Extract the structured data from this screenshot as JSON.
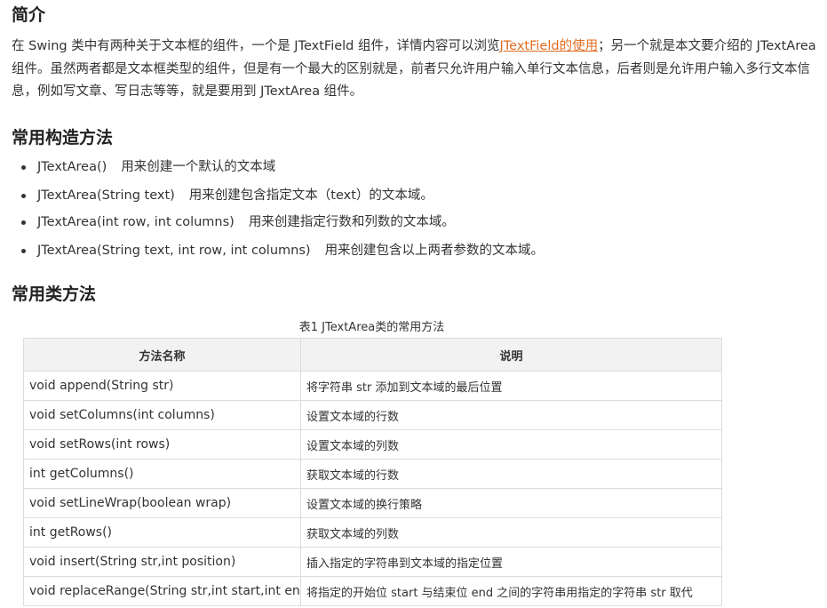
{
  "intro": {
    "heading": "简介",
    "text_before_link": "在 Swing 类中有两种关于文本框的组件，一个是 JTextField 组件，详情内容可以浏览",
    "link_text": "JTextField的使用",
    "text_after_link": "；另一个就是本文要介绍的 JTextArea 组件。虽然两者都是文本框类型的组件，但是有一个最大的区别就是，前者只允许用户输入单行文本信息，后者则是允许用户输入多行文本信息，例如写文章、写日志等等，就是要用到 JTextArea 组件。"
  },
  "constructors": {
    "heading": "常用构造方法",
    "items": [
      {
        "signature": "JTextArea()",
        "description": "用来创建一个默认的文本域"
      },
      {
        "signature": "JTextArea(String text)",
        "description": "用来创建包含指定文本（text）的文本域。"
      },
      {
        "signature": "JTextArea(int row, int columns)",
        "description": "用来创建指定行数和列数的文本域。"
      },
      {
        "signature": "JTextArea(String text, int row, int columns)",
        "description": "用来创建包含以上两者参数的文本域。"
      }
    ]
  },
  "methods": {
    "heading": "常用类方法",
    "caption": "表1 JTextArea类的常用方法",
    "columns": [
      "方法名称",
      "说明"
    ],
    "rows": [
      [
        "void append(String str)",
        "将字符串 str 添加到文本域的最后位置"
      ],
      [
        "void setColumns(int columns)",
        "设置文本域的行数"
      ],
      [
        "void setRows(int rows)",
        "设置文本域的列数"
      ],
      [
        "int getColumns()",
        "获取文本域的行数"
      ],
      [
        "void setLineWrap(boolean wrap)",
        "设置文本域的换行策略"
      ],
      [
        "int getRows()",
        "获取文本域的列数"
      ],
      [
        "void insert(String str,int position)",
        "插入指定的字符串到文本域的指定位置"
      ],
      [
        "void replaceRange(String str,int start,int end)",
        "将指定的开始位 start 与结束位 end 之间的字符串用指定的字符串 str 取代"
      ]
    ]
  },
  "colors": {
    "link": "#e06c21",
    "text": "#333333",
    "header_bg": "#f2f2f2",
    "border": "#dcdcdc"
  }
}
